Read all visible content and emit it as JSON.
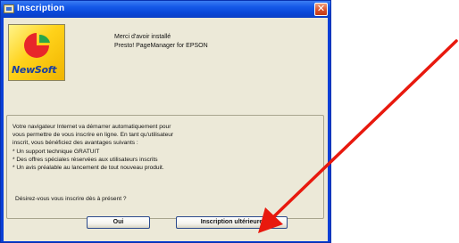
{
  "window": {
    "title": "Inscription",
    "close_glyph": "✕"
  },
  "logo": {
    "brand": "NewSoft",
    "colors": {
      "background": "#ffd21a",
      "red": "#e8262a",
      "green": "#2aa54a",
      "word": "#1a3fa0"
    }
  },
  "thanks": {
    "line1": "Merci d'avoir installé",
    "line2": "Presto! PageManager for EPSON"
  },
  "message": {
    "lines": [
      "Votre navigateur Internet va démarrer automatiquement pour",
      "vous permettre de vous inscrire en ligne. En tant qu'utilisateur",
      "inscrit, vous bénéficiez des avantages suivants :",
      "* Un support technique GRATUIT",
      "* Des offres spéciales réservées aux utilisateurs inscrits",
      "* Un avis préalable au lancement de tout nouveau produit."
    ],
    "question": "Désirez-vous vous inscrire dès à présent ?"
  },
  "buttons": {
    "yes": "Oui",
    "later": "Inscription ultérieure"
  },
  "annotation": {
    "arrow_color": "#e8190e"
  }
}
